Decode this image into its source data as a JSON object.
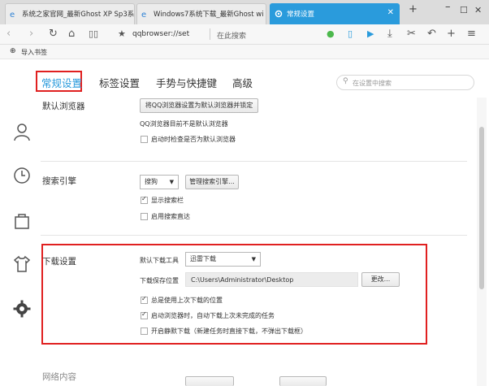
{
  "tabs": [
    {
      "title": "系统之家官网_最新Ghost XP Sp3系",
      "active": false
    },
    {
      "title": "Windows7系统下载_最新Ghost wi",
      "active": false
    },
    {
      "title": "常规设置",
      "active": true
    }
  ],
  "address": {
    "url": "qqbrowser://set",
    "search_placeholder": "在此搜索"
  },
  "bookmarks": {
    "import_label": "导入书签"
  },
  "settings_tabs": [
    "常规设置",
    "标签设置",
    "手势与快捷键",
    "高级"
  ],
  "settings_search_placeholder": "在设置中搜索",
  "default_browser": {
    "title": "默认浏览器",
    "set_button": "将QQ浏览器设置为默认浏览器并锁定",
    "status": "QQ浏览器目前不是默认浏览器",
    "check_on_start": "启动时检查是否为默认浏览器"
  },
  "search_engine": {
    "title": "搜索引擎",
    "selected": "搜狗",
    "manage_button": "管理搜索引擎...",
    "show_search_bar": "显示搜索栏",
    "direct_search": "启用搜索直达"
  },
  "download": {
    "title": "下载设置",
    "tool_label": "默认下载工具",
    "tool_selected": "迅雷下载",
    "path_label": "下载保存位置",
    "path_value": "C:\\Users\\Administrator\\Desktop",
    "change_button": "更改...",
    "always_last": "总是使用上次下载的位置",
    "resume_unfinished": "启动浏览器时，自动下载上次未完成的任务",
    "silent_download": "开启静默下载（新建任务时直接下载，不弹出下载框）"
  },
  "network": {
    "title": "网络内容"
  },
  "colors": {
    "accent": "#2a9bdc",
    "highlight": "#e02020"
  }
}
